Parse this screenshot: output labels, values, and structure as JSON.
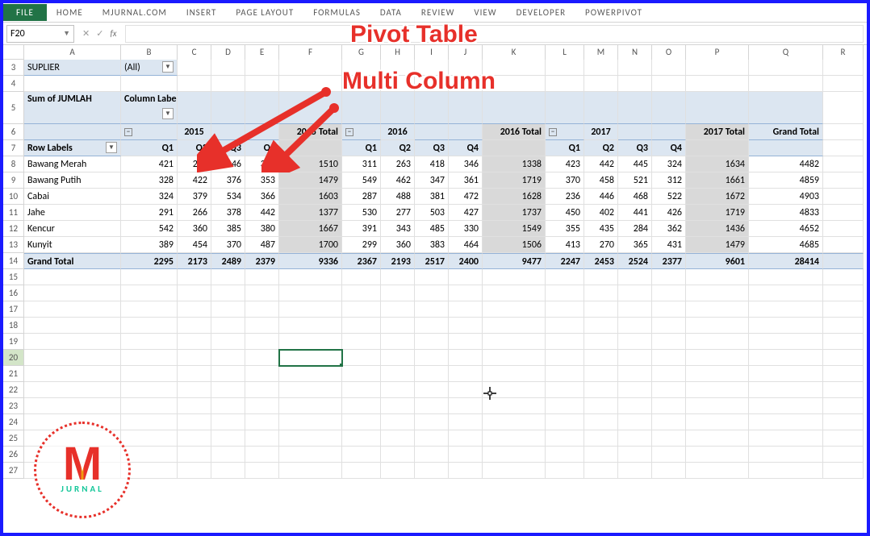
{
  "ribbon": {
    "tabs": [
      "FILE",
      "HOME",
      "MJURNAL.COM",
      "INSERT",
      "PAGE LAYOUT",
      "FORMULAS",
      "DATA",
      "REVIEW",
      "VIEW",
      "DEVELOPER",
      "POWERPIVOT"
    ]
  },
  "name_box": "F20",
  "fx_label": "fx",
  "columns": [
    "A",
    "B",
    "C",
    "D",
    "E",
    "F",
    "G",
    "H",
    "I",
    "J",
    "K",
    "L",
    "M",
    "N",
    "O",
    "P",
    "Q",
    "R"
  ],
  "row_start": 3,
  "row_end": 27,
  "pivot": {
    "filter_field": "SUPLIER",
    "filter_value": "(All)",
    "value_field": "Sum of JUMLAH",
    "col_label": "Column Labels",
    "row_label": "Row Labels",
    "years": [
      "2015",
      "2016",
      "2017"
    ],
    "quarters": [
      "Q1",
      "Q2",
      "Q3",
      "Q4"
    ],
    "year_total_labels": [
      "2015 Total",
      "2016 Total",
      "2017 Total"
    ],
    "grand_total_label": "Grand Total",
    "rows": [
      {
        "label": "Bawang Merah",
        "v": [
          421,
          292,
          446,
          351,
          1510,
          311,
          263,
          418,
          346,
          1338,
          423,
          442,
          445,
          324,
          1634,
          4482
        ]
      },
      {
        "label": "Bawang Putih",
        "v": [
          328,
          422,
          376,
          353,
          1479,
          549,
          462,
          347,
          361,
          1719,
          370,
          458,
          521,
          312,
          1661,
          4859
        ]
      },
      {
        "label": "Cabai",
        "v": [
          324,
          379,
          534,
          366,
          1603,
          287,
          488,
          381,
          472,
          1628,
          236,
          446,
          468,
          522,
          1672,
          4903
        ]
      },
      {
        "label": "Jahe",
        "v": [
          291,
          266,
          378,
          442,
          1377,
          530,
          277,
          503,
          427,
          1737,
          450,
          402,
          441,
          426,
          1719,
          4833
        ]
      },
      {
        "label": "Kencur",
        "v": [
          542,
          360,
          385,
          380,
          1667,
          391,
          343,
          485,
          330,
          1549,
          355,
          435,
          284,
          362,
          1436,
          4652
        ]
      },
      {
        "label": "Kunyit",
        "v": [
          389,
          454,
          370,
          487,
          1700,
          299,
          360,
          383,
          464,
          1506,
          413,
          270,
          365,
          431,
          1479,
          4685
        ]
      }
    ],
    "grand_row": {
      "label": "Grand Total",
      "v": [
        2295,
        2173,
        2489,
        2379,
        9336,
        2367,
        2193,
        2517,
        2400,
        9477,
        2247,
        2453,
        2524,
        2377,
        9601,
        28414
      ]
    }
  },
  "annotation": {
    "line1": "Pivot Table",
    "line2": "Multi Column"
  },
  "watermark": {
    "m": "M",
    "sub": "JURNAL"
  }
}
